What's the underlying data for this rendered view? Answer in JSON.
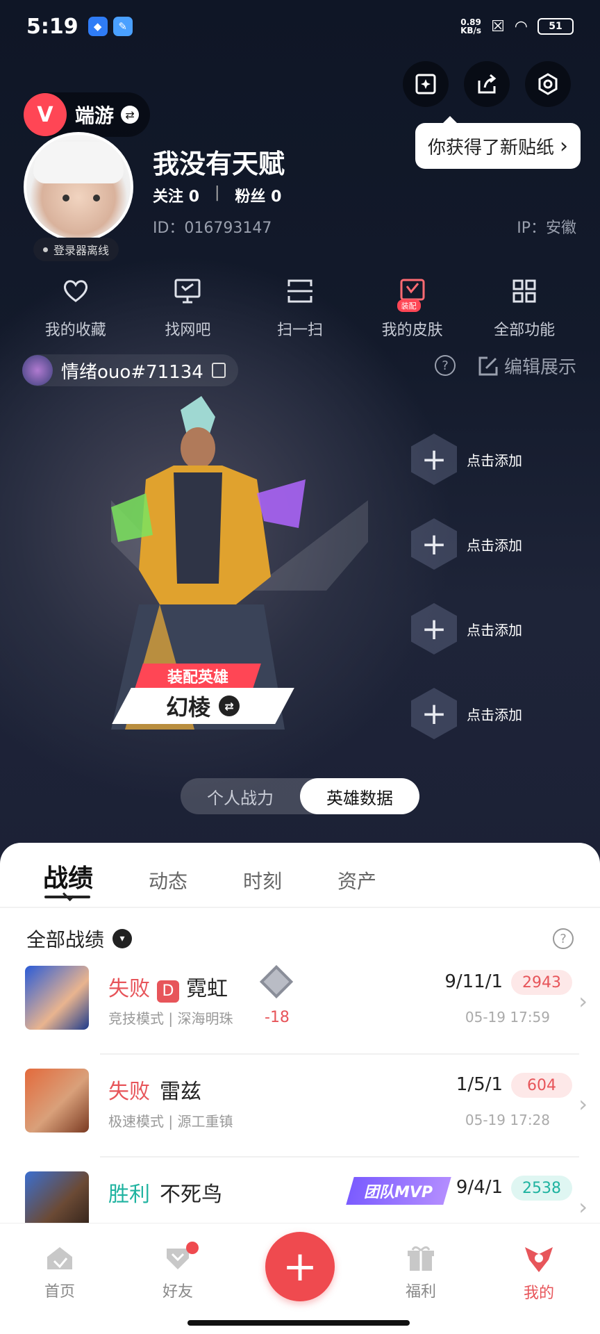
{
  "status_bar": {
    "time": "5:19",
    "net_speed_value": "0.89",
    "net_speed_unit": "KB/s",
    "battery": "51"
  },
  "colors": {
    "accent": "#ff4655",
    "loss": "#e7555a",
    "win": "#1fb3a0",
    "mvp": "#8f6bff"
  },
  "tooltip": {
    "text": "你获得了新贴纸",
    "chevron": "›"
  },
  "brand": {
    "logo": "V",
    "name": "端游",
    "swap_glyph": "⇄"
  },
  "profile": {
    "nickname": "我没有天赋",
    "follow_label": "关注",
    "follow_count": "0",
    "fans_label": "粉丝",
    "fans_count": "0",
    "id_text": "ID：016793147",
    "ip_text": "IP：安徽",
    "offline_text": "登录器离线"
  },
  "quick_menu": [
    {
      "label": "我的收藏",
      "icon": "heart-icon"
    },
    {
      "label": "找网吧",
      "icon": "monitor-icon"
    },
    {
      "label": "扫一扫",
      "icon": "scan-icon"
    },
    {
      "label": "我的皮肤",
      "icon": "skin-icon",
      "badge": "装配"
    },
    {
      "label": "全部功能",
      "icon": "grid-icon"
    }
  ],
  "player": {
    "name": "情绪ouo#71134"
  },
  "showcase": {
    "edit_label": "编辑展示",
    "help_glyph": "?",
    "equip_label": "装配英雄",
    "hero_name": "幻棱",
    "slots": [
      "点击添加",
      "点击添加",
      "点击添加",
      "点击添加"
    ],
    "slot_glyph": "+"
  },
  "toggle": {
    "left": "个人战力",
    "right": "英雄数据"
  },
  "tabs": [
    "战绩",
    "动态",
    "时刻",
    "资产"
  ],
  "filter": {
    "label": "全部战绩",
    "glyph": "▾"
  },
  "matches": [
    {
      "result": "失败",
      "rank": "D",
      "agent": "霓虹",
      "mode": "竞技模式 | 深海明珠",
      "rr": "-18",
      "kda": "9/11/1",
      "score": "2943",
      "date": "05-19 17:59"
    },
    {
      "result": "失败",
      "agent": "雷兹",
      "mode": "极速模式 | 源工重镇",
      "kda": "1/5/1",
      "score": "604",
      "date": "05-19 17:28"
    },
    {
      "result": "胜利",
      "agent": "不死鸟",
      "mvp": "团队MVP",
      "kda": "9/4/1",
      "score": "2538"
    }
  ],
  "bottom_nav": [
    {
      "label": "首页",
      "icon": "home-icon"
    },
    {
      "label": "好友",
      "icon": "friends-icon"
    },
    {
      "label": "福利",
      "icon": "gift-icon"
    },
    {
      "label": "我的",
      "icon": "me-icon"
    }
  ],
  "fab_glyph": "+"
}
